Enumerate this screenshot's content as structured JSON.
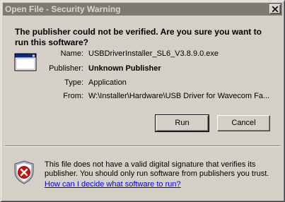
{
  "window": {
    "title": "Open File - Security Warning"
  },
  "heading": "The publisher could not be verified.  Are you sure you want to run this software?",
  "file_info": [
    {
      "label": "Name:",
      "value": "USBDriverInstaller_SL6_V3.8.9.0.exe",
      "bold": false
    },
    {
      "label": "Publisher:",
      "value": "Unknown Publisher",
      "bold": true
    },
    {
      "label": "Type:",
      "value": "Application",
      "bold": false
    },
    {
      "label": "From:",
      "value": "W:\\Installer\\Hardware\\USB Driver for Wavecom Fa...",
      "bold": false
    }
  ],
  "buttons": {
    "run": "Run",
    "cancel": "Cancel"
  },
  "warning": {
    "text": "This file does not have a valid digital signature that verifies its publisher.  You should only run software from publishers you trust.",
    "link": "How can I decide what software to run?"
  },
  "icons": {
    "close": "close-icon",
    "file": "application-file-icon",
    "warning": "security-shield-icon"
  },
  "colors": {
    "titlebar": "#7d7a74",
    "face": "#d4d0c8",
    "link": "#0000ff",
    "shield_red": "#cc1010"
  }
}
